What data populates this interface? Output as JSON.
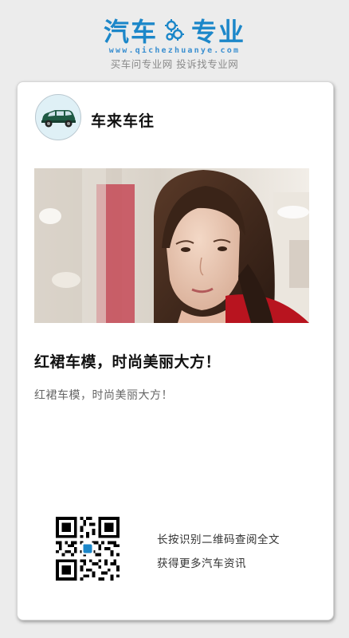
{
  "brand": {
    "left_word": "汽车",
    "right_word": "专业",
    "url": "www.qichezhuanye.com",
    "slogan": "买车问专业网 投诉找专业网",
    "color": "#1c87c9",
    "logo_icon": "gear-icon"
  },
  "card": {
    "author": "车来车往",
    "avatar_icon": "car-icon",
    "image_description": "",
    "headline": "红裙车模，时尚美丽大方！",
    "summary": "红裙车模，时尚美丽大方！",
    "qr": {
      "icon": "qr-code-icon",
      "line_1": "长按识别二维码查阅全文",
      "line_2": "获得更多汽车资讯"
    }
  }
}
